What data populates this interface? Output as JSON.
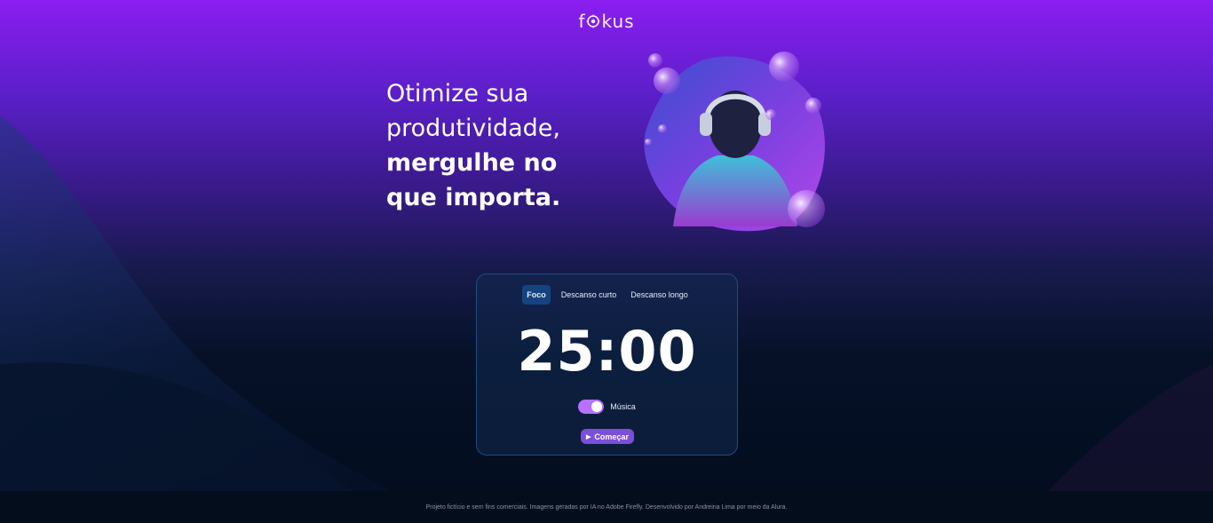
{
  "header": {
    "logo_text_1": "f",
    "logo_text_2": "kus",
    "logo_icon": "fokus-logo-ring-icon"
  },
  "hero": {
    "line1": "Otimize sua",
    "line2": "produtividade,",
    "line3": "mergulhe no",
    "line4": "que importa.",
    "image": "astronaut-with-headphones-illustration"
  },
  "timer": {
    "tabs": [
      {
        "label": "Foco",
        "active": true
      },
      {
        "label": "Descanso curto",
        "active": false
      },
      {
        "label": "Descanso longo",
        "active": false
      }
    ],
    "time": "25:00",
    "music_label": "Música",
    "music_on": true,
    "start_label": "Começar",
    "start_icon": "play-icon"
  },
  "footer": {
    "text": "Projeto fictício e sem fins comerciais. Imagens geradas por IA no Adobe Firefly. Desenvolvido por Andreina Lima por meio da Alura."
  },
  "colors": {
    "accent": "#b872ff",
    "button": "#7b4fd9",
    "tab_active": "#144480",
    "card_border": "#234a80"
  }
}
